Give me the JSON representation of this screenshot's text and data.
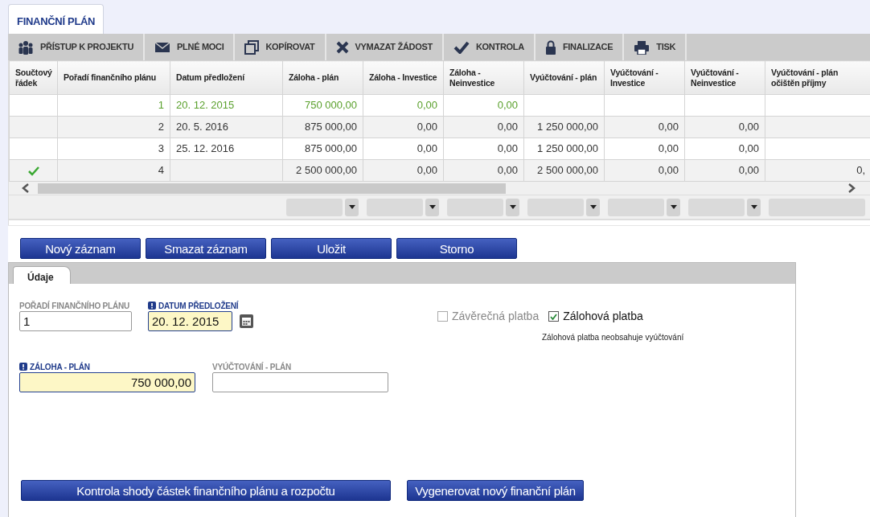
{
  "tab": {
    "label": "FINANČNÍ PLÁN",
    "selected": true
  },
  "toolbar": [
    {
      "label": "PŘÍSTUP K PROJEKTU"
    },
    {
      "label": "PLNÉ MOCI"
    },
    {
      "label": "KOPÍROVAT"
    },
    {
      "label": "VYMAZAT ŽÁDOST"
    },
    {
      "label": "KONTROLA"
    },
    {
      "label": "FINALIZACE"
    },
    {
      "label": "TISK"
    }
  ],
  "table": {
    "columns": [
      "Součtový řádek",
      "Pořadí finančního plánu",
      "Datum předložení",
      "Záloha - plán",
      "Záloha - Investice",
      "Záloha - Neinvestice",
      "Vyúčtování - plán",
      "Vyúčtování - Investice",
      "Vyúčtování - Neinvestice",
      "Vyúčtování - plán očištěn příjmy"
    ],
    "rows": [
      {
        "selected": true,
        "summary": false,
        "cells": [
          "",
          "1",
          "20. 12. 2015",
          "750 000,00",
          "0,00",
          "0,00",
          "",
          "",
          "",
          ""
        ]
      },
      {
        "selected": false,
        "summary": false,
        "cells": [
          "",
          "2",
          "20. 5. 2016",
          "875 000,00",
          "0,00",
          "0,00",
          "1 250 000,00",
          "0,00",
          "0,00",
          ""
        ]
      },
      {
        "selected": false,
        "summary": false,
        "cells": [
          "",
          "3",
          "25. 12. 2016",
          "875 000,00",
          "0,00",
          "0,00",
          "1 250 000,00",
          "0,00",
          "0,00",
          ""
        ]
      },
      {
        "selected": false,
        "summary": true,
        "cells": [
          "",
          "4",
          "",
          "2 500 000,00",
          "0,00",
          "0,00",
          "2 500 000,00",
          "0,00",
          "0,00",
          "0,"
        ]
      }
    ]
  },
  "actions": [
    "Nový záznam",
    "Smazat záznam",
    "Uložit",
    "Storno"
  ],
  "form": {
    "tab": {
      "label": "Údaje",
      "selected": true
    },
    "fields": [
      {
        "label": "POŘADÍ FINANČNÍHO PLÁNU",
        "value": "1",
        "required": false,
        "kind": "text"
      },
      {
        "label": "DATUM PŘEDLOŽENÍ",
        "value": "20. 12. 2015",
        "required": true,
        "kind": "date"
      },
      {
        "label": "ZÁLOHA - PLÁN",
        "value": "750 000,00",
        "required": true,
        "kind": "amount"
      },
      {
        "label": "VYÚČTOVÁNÍ - PLÁN",
        "required": false,
        "kind": "amount"
      }
    ],
    "checkboxes": [
      {
        "label": "Závěrečná platba",
        "checked": false
      },
      {
        "label": "Zálohová platba",
        "checked": true
      }
    ],
    "note": "Zálohová platba neobsahuje vyúčtování",
    "buttons": [
      "Kontrola shody částek finančního plánu a rozpočtu",
      "Vygenerovat nový finanční plán"
    ]
  }
}
